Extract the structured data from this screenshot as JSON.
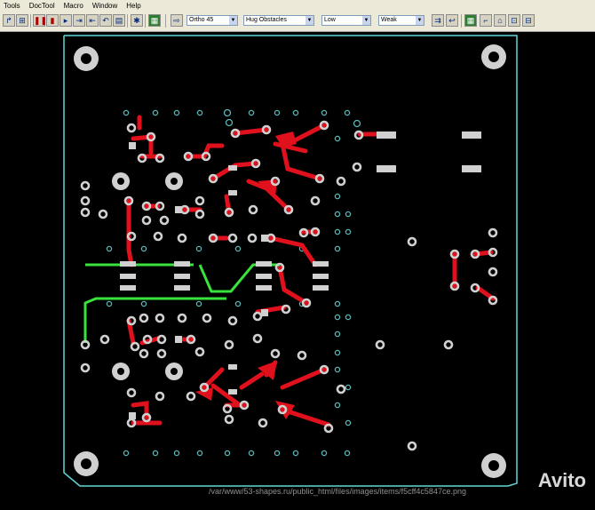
{
  "menu": [
    "Tools",
    "DocTool",
    "Macro",
    "Window",
    "Help"
  ],
  "toolbar": {
    "dropdown_angle": "Ortho 45",
    "dropdown_obstacle": "Hug Obstacles",
    "dropdown_level": "Low",
    "dropdown_weak": "Weak"
  },
  "watermark": "Avito",
  "watermark_url": "/var/www/53-shapes.ru/public_html/files/images/items/f5cff4c5847ce.png",
  "colors": {
    "background": "#000000",
    "board_outline": "#5fd7d7",
    "trace_red": "#e0101c",
    "trace_green": "#39e23c",
    "pad": "#d0d0d0",
    "via": "#5ab8b8"
  }
}
